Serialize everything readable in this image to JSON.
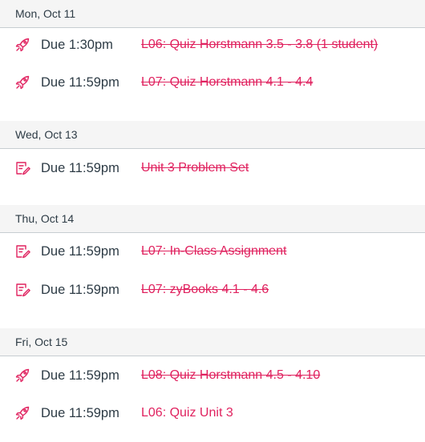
{
  "accent_color": "#e0225f",
  "days": [
    {
      "label": "Mon, Oct 11",
      "items": [
        {
          "icon": "quiz-rocket-icon",
          "due": "Due 1:30pm",
          "title": "L06: Quiz Horstmann 3.5 - 3.8 (1 student)",
          "completed": true
        },
        {
          "icon": "quiz-rocket-icon",
          "due": "Due 11:59pm",
          "title": "L07: Quiz Horstmann 4.1 - 4.4",
          "completed": true
        }
      ]
    },
    {
      "label": "Wed, Oct 13",
      "items": [
        {
          "icon": "assignment-icon",
          "due": "Due 11:59pm",
          "title": "Unit 3 Problem Set",
          "completed": true
        }
      ]
    },
    {
      "label": "Thu, Oct 14",
      "items": [
        {
          "icon": "assignment-icon",
          "due": "Due 11:59pm",
          "title": "L07: In-Class Assignment",
          "completed": true
        },
        {
          "icon": "assignment-icon",
          "due": "Due 11:59pm",
          "title": "L07: zyBooks 4.1 - 4.6",
          "completed": true
        }
      ]
    },
    {
      "label": "Fri, Oct 15",
      "items": [
        {
          "icon": "quiz-rocket-icon",
          "due": "Due 11:59pm",
          "title": "L08: Quiz Horstmann 4.5 - 4.10",
          "completed": true
        },
        {
          "icon": "quiz-rocket-icon",
          "due": "Due 11:59pm",
          "title": "L06: Quiz Unit 3",
          "completed": false
        }
      ]
    }
  ]
}
